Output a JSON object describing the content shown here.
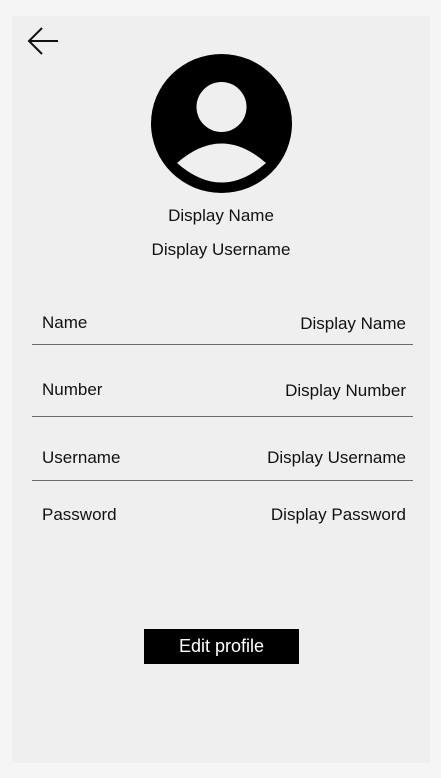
{
  "icons": {
    "back": "arrow-left-icon",
    "avatar": "user-avatar-icon"
  },
  "colors": {
    "background": "#efefef",
    "button_background": "#000000",
    "button_text": "#ffffff",
    "divider": "#6a6a6a"
  },
  "header": {
    "display_name": "Display Name",
    "display_username": "Display Username"
  },
  "fields": {
    "name": {
      "label": "Name",
      "value": "Display Name"
    },
    "number": {
      "label": "Number",
      "value": "Display Number"
    },
    "username": {
      "label": "Username",
      "value": "Display Username"
    },
    "password": {
      "label": "Password",
      "value": "Display Password"
    }
  },
  "actions": {
    "edit_profile_label": "Edit profile"
  }
}
